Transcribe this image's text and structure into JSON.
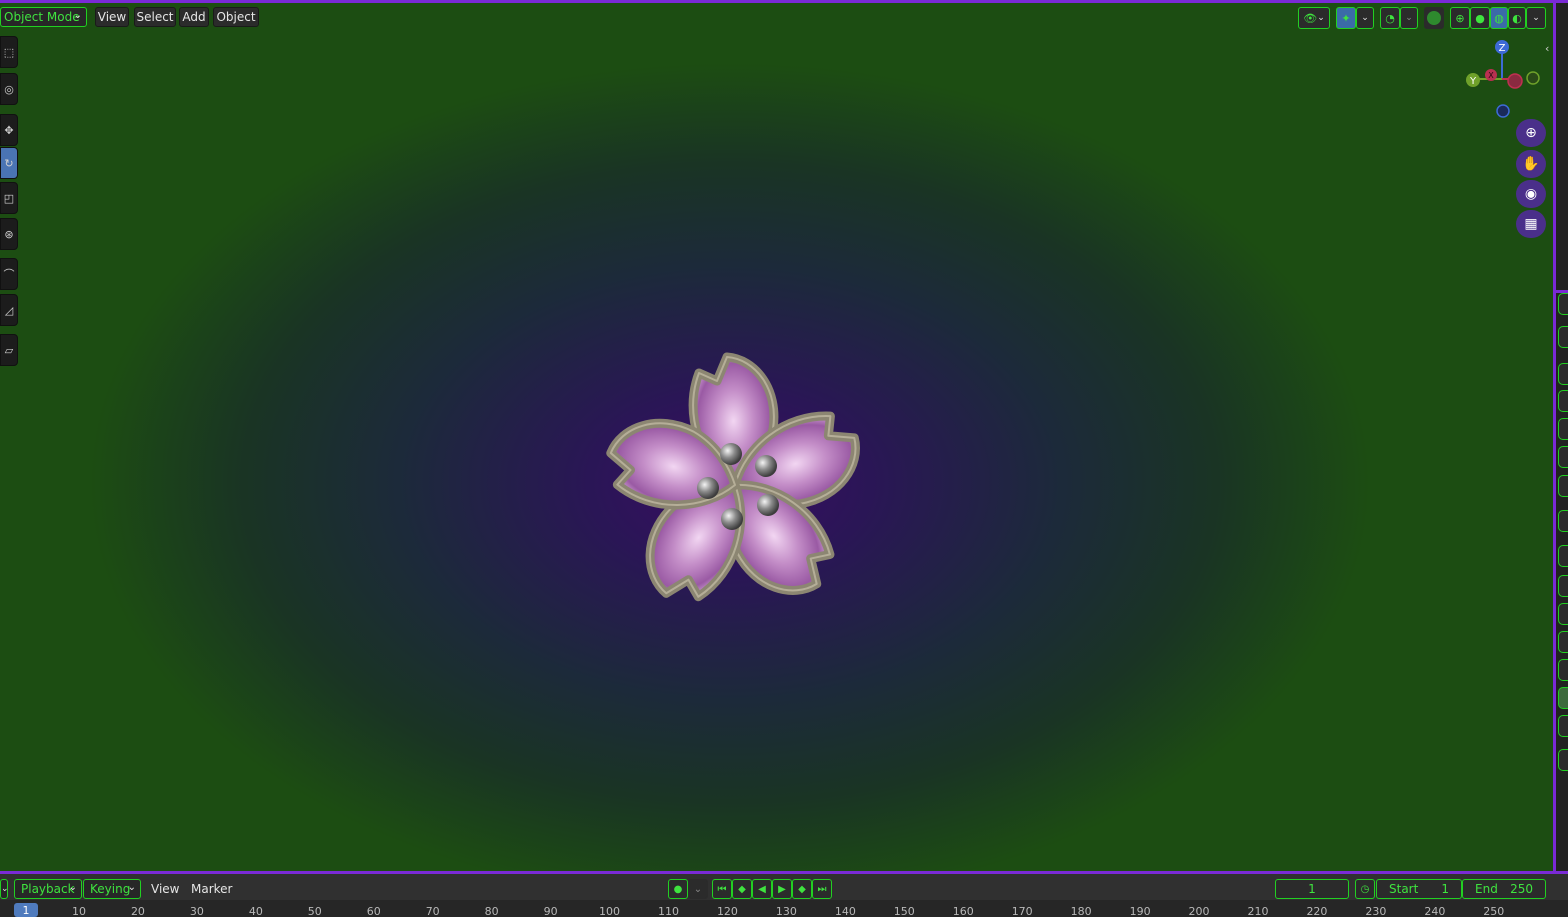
{
  "header": {
    "mode_label": "Object Mode",
    "menus": [
      "View",
      "Select",
      "Add",
      "Object"
    ]
  },
  "gizmo": {
    "z": "Z",
    "y": "Y",
    "x": "X"
  },
  "timeline": {
    "playback_label": "Playback",
    "keying_label": "Keying",
    "menus": [
      "View",
      "Marker"
    ],
    "current_frame": "1",
    "start_label": "Start",
    "start_value": "1",
    "end_label": "End",
    "end_value": "250",
    "ruler_current": "1",
    "ruler_ticks": [
      "10",
      "20",
      "30",
      "40",
      "50",
      "60",
      "70",
      "80",
      "90",
      "100",
      "110",
      "120",
      "130",
      "140",
      "150",
      "160",
      "170",
      "180",
      "190",
      "200",
      "210",
      "220",
      "230",
      "240",
      "250"
    ]
  },
  "colors": {
    "accent": "#7a2ad6",
    "highlight_text": "#3fe33f",
    "active_tool": "#4a74b4"
  }
}
